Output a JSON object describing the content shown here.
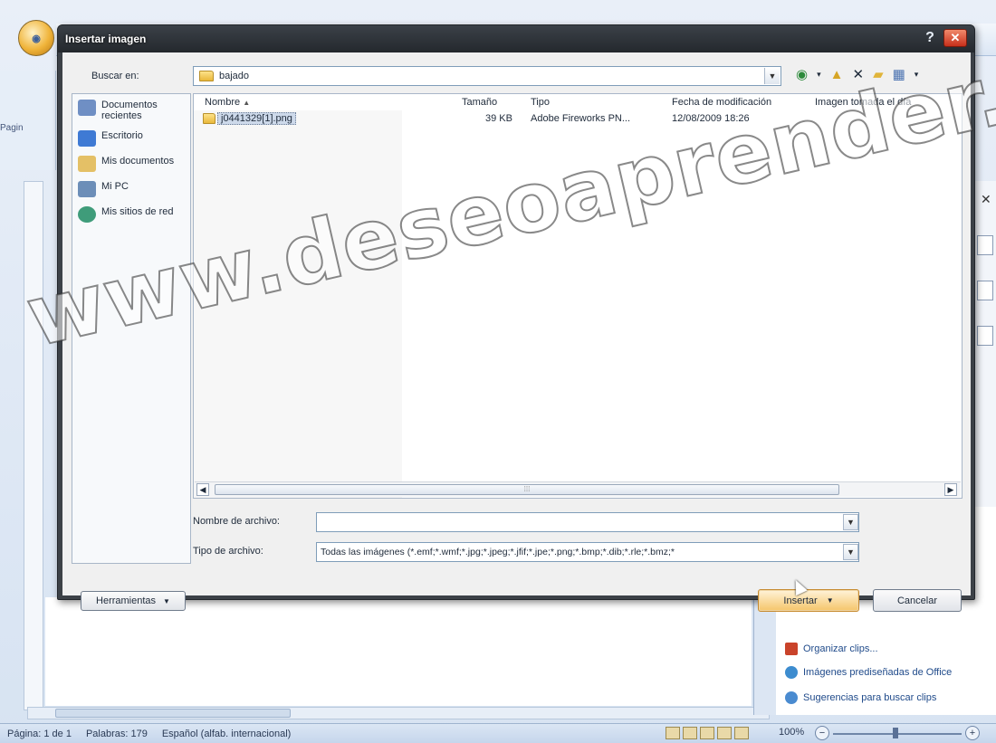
{
  "dialog": {
    "title": "Insertar imagen",
    "help_glyph": "?",
    "close_glyph": "✕"
  },
  "look_in": {
    "label": "Buscar en:",
    "value": "bajado"
  },
  "places": [
    {
      "label": "Documentos recientes",
      "icon": "recent-documents-icon",
      "color": "#6f8fc4"
    },
    {
      "label": "Escritorio",
      "icon": "desktop-icon",
      "color": "#3f7ad4"
    },
    {
      "label": "Mis documentos",
      "icon": "my-documents-icon",
      "color": "#e4c066"
    },
    {
      "label": "Mi PC",
      "icon": "my-computer-icon",
      "color": "#6c8eb8"
    },
    {
      "label": "Mis sitios de red",
      "icon": "network-places-icon",
      "color": "#3f9c7a"
    }
  ],
  "file_list": {
    "columns": [
      "Nombre",
      "Tamaño",
      "Tipo",
      "Fecha de modificación",
      "Imagen tomada el día"
    ],
    "sort_indicator": "▲",
    "rows": [
      {
        "name": "j0441329[1].png",
        "size": "39 KB",
        "type": "Adobe Fireworks PN...",
        "modified": "12/08/2009 18:26"
      }
    ]
  },
  "file_name": {
    "label": "Nombre de archivo:",
    "value": ""
  },
  "file_type": {
    "label": "Tipo de archivo:",
    "value": "Todas las imágenes (*.emf;*.wmf;*.jpg;*.jpeg;*.jfif;*.jpe;*.png;*.bmp;*.dib;*.rle;*.bmz;*"
  },
  "buttons": {
    "tools": "Herramientas",
    "insert": "Insertar",
    "cancel": "Cancelar"
  },
  "background": {
    "ribbon_partial": "Pagin",
    "task_links": [
      {
        "label": "Organizar clips...",
        "color": "#c9432a"
      },
      {
        "label": "Imágenes prediseñadas de Office",
        "color": "#3d8ccf"
      },
      {
        "label": "Sugerencias para buscar clips",
        "color": "#4a8bd0"
      }
    ],
    "status": {
      "page": "Página: 1 de 1",
      "words": "Palabras: 179",
      "language": "Español (alfab. internacional)",
      "zoom": "100%"
    }
  },
  "watermark": "www.deseoaprender.com"
}
